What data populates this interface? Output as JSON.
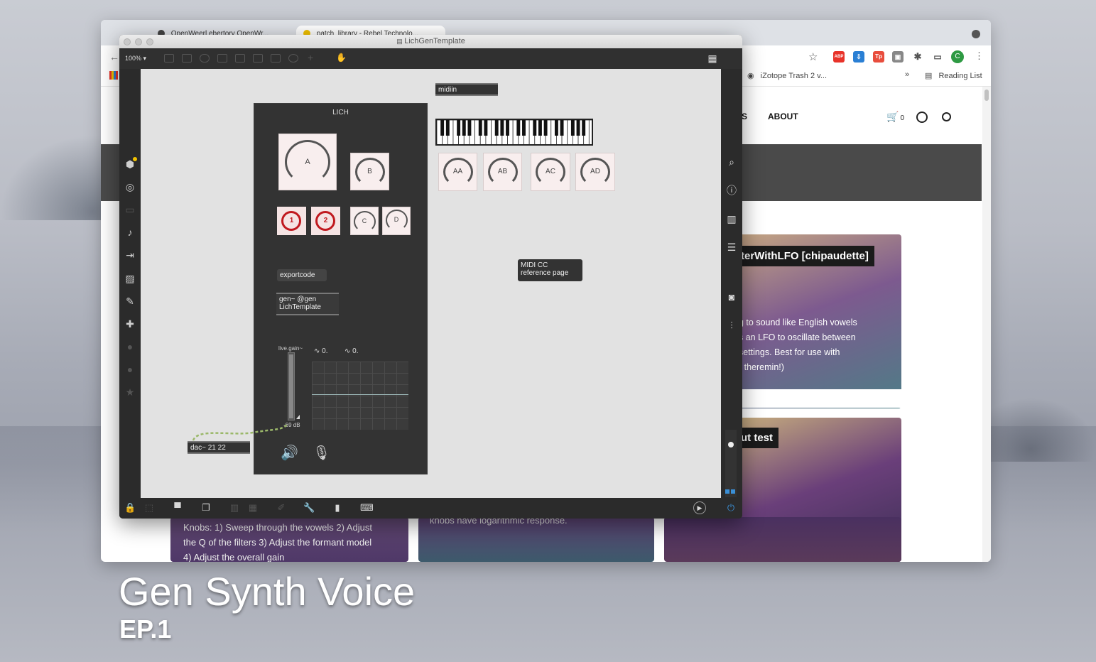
{
  "overlay": {
    "title": "Gen Synth Voice",
    "subtitle": "EP.1"
  },
  "browser": {
    "tabs": [
      {
        "label": "OpenWeerl ebertory OpenWr..."
      },
      {
        "label": "patch_library - Rebel Technolo..."
      }
    ],
    "bookmark_item": "iZotope Trash 2 v...",
    "bookmark_overflow": "»",
    "reading_list": "Reading List",
    "profile_initial": "C",
    "site": {
      "nav_partial": "S",
      "nav_about": "ABOUT",
      "cart_count": "0",
      "card_a_title": "terWithLFO [chipaudette]",
      "card_a_lines": [
        "g to sound like English vowels",
        "s an LFO to oscillate between",
        "settings. Best for use with",
        "r theremin!)"
      ],
      "card_b_title": "ut test",
      "card_c_lines": [
        "Knobs: 1) Sweep through the vowels 2) Adjust",
        "the Q of the filters 3) Adjust the formant model",
        "4) Adjust the overall gain"
      ],
      "card_d_text": "knobs have logarithmic response."
    },
    "colors": {
      "profile": "#2e9a43",
      "ext_abp": "#e8332a",
      "ext_blue": "#2a7fd4",
      "ext_tp": "#e84d3d"
    }
  },
  "max": {
    "window_title": "LichGenTemplate",
    "zoom": "100%",
    "patch": {
      "panel_title": "LICH",
      "dials": {
        "big": "A",
        "b": "B",
        "c": "C",
        "d": "D",
        "aa": "AA",
        "ab": "AB",
        "ac": "AC",
        "ad": "AD"
      },
      "red_buttons": [
        "1",
        "2"
      ],
      "exportcode": "exportcode",
      "gen_obj_line1": "gen~ @gen",
      "gen_obj_line2": "LichTemplate",
      "midiin": "midiin",
      "midicc_line1": "MIDI CC",
      "midicc_line2": "reference page",
      "gain_label": "live.gain~",
      "gain_db": "-69 dB",
      "num1": "0.",
      "num2": "0.",
      "dac": "dac~ 21 22"
    }
  }
}
